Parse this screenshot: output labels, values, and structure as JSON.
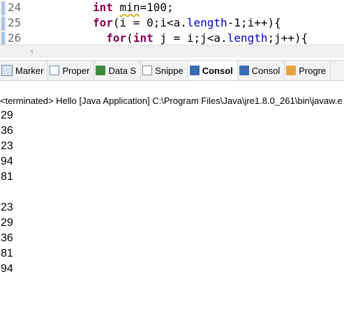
{
  "editor": {
    "lines": [
      {
        "num": "24",
        "code_parts": [
          {
            "t": "int",
            "c": "kw"
          },
          {
            "t": " ",
            "c": ""
          },
          {
            "t": "min",
            "c": "warn"
          },
          {
            "t": "=100;",
            "c": ""
          }
        ]
      },
      {
        "num": "25",
        "code_parts": [
          {
            "t": "for",
            "c": "kw"
          },
          {
            "t": "(i = 0;i<a.",
            "c": ""
          },
          {
            "t": "length",
            "c": "fld"
          },
          {
            "t": "-1;i++){",
            "c": ""
          }
        ]
      },
      {
        "num": "26",
        "code_parts": [
          {
            "t": "  ",
            "c": ""
          },
          {
            "t": "for",
            "c": "kw"
          },
          {
            "t": "(",
            "c": ""
          },
          {
            "t": "int",
            "c": "kw"
          },
          {
            "t": " j = i;j<a.",
            "c": ""
          },
          {
            "t": "length",
            "c": "fld"
          },
          {
            "t": ";j++){",
            "c": ""
          }
        ]
      }
    ]
  },
  "tabs": [
    {
      "label": "Marker",
      "icon": "markers-icon",
      "active": false
    },
    {
      "label": "Proper",
      "icon": "properties-icon",
      "active": false
    },
    {
      "label": "Data S",
      "icon": "data-source-icon",
      "active": false
    },
    {
      "label": "Snippe",
      "icon": "snippets-icon",
      "active": false
    },
    {
      "label": "Consol",
      "icon": "console-icon",
      "active": true
    },
    {
      "label": "Consol",
      "icon": "console-icon",
      "active": false
    },
    {
      "label": "Progre",
      "icon": "progress-icon",
      "active": false
    }
  ],
  "console": {
    "header": "<terminated> Hello [Java Application] C:\\Program Files\\Java\\jre1.8.0_261\\bin\\javaw.e",
    "output": [
      "29",
      "36",
      "23",
      "94",
      "81",
      "",
      "23",
      "29",
      "36",
      "81",
      "94"
    ]
  },
  "colors": {
    "keyword": "#7f0055",
    "field": "#0000c0",
    "active_tab_bg": "#ffffff",
    "tab_strip_bg": "#f2f2f2"
  }
}
